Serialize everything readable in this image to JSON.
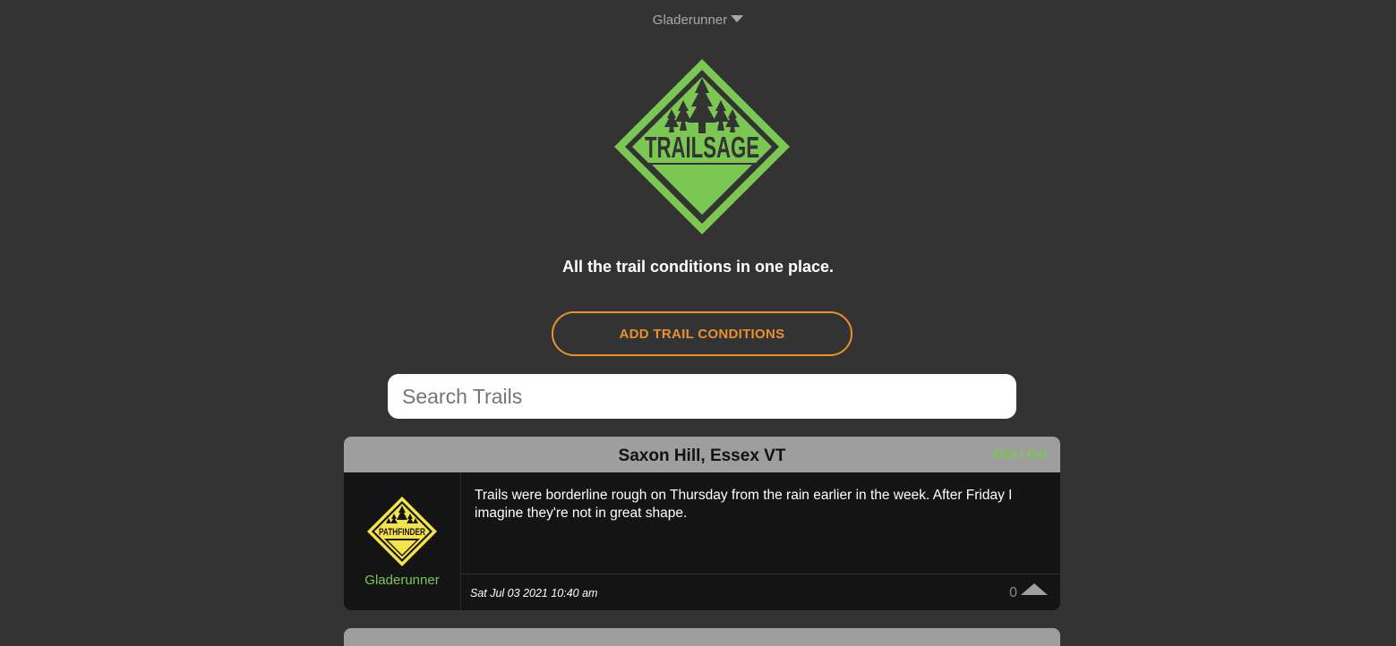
{
  "header": {
    "username": "Gladerunner"
  },
  "logo": {
    "text": "TRAILSAGE",
    "color": "#7cc653"
  },
  "tagline": "All the trail conditions in one place.",
  "add_button": {
    "label": "ADD TRAIL CONDITIONS",
    "color": "#e8912f"
  },
  "search": {
    "placeholder": "Search Trails",
    "value": ""
  },
  "posts": [
    {
      "trail": "Saxon Hill, Essex VT",
      "edit_label": "Edit",
      "separator": "|",
      "delete_label": "Del",
      "badge_text": "PATHFINDER",
      "author": "Gladerunner",
      "body": "Trails were borderline rough on Thursday from the rain earlier in the week. After Friday I imagine they're not in great shape.",
      "timestamp": "Sat Jul 03 2021 10:40 am",
      "votes": "0"
    }
  ],
  "colors": {
    "background": "#333333",
    "accent_green": "#7cc653",
    "accent_orange": "#e8912f",
    "badge_yellow": "#f5e34a"
  }
}
